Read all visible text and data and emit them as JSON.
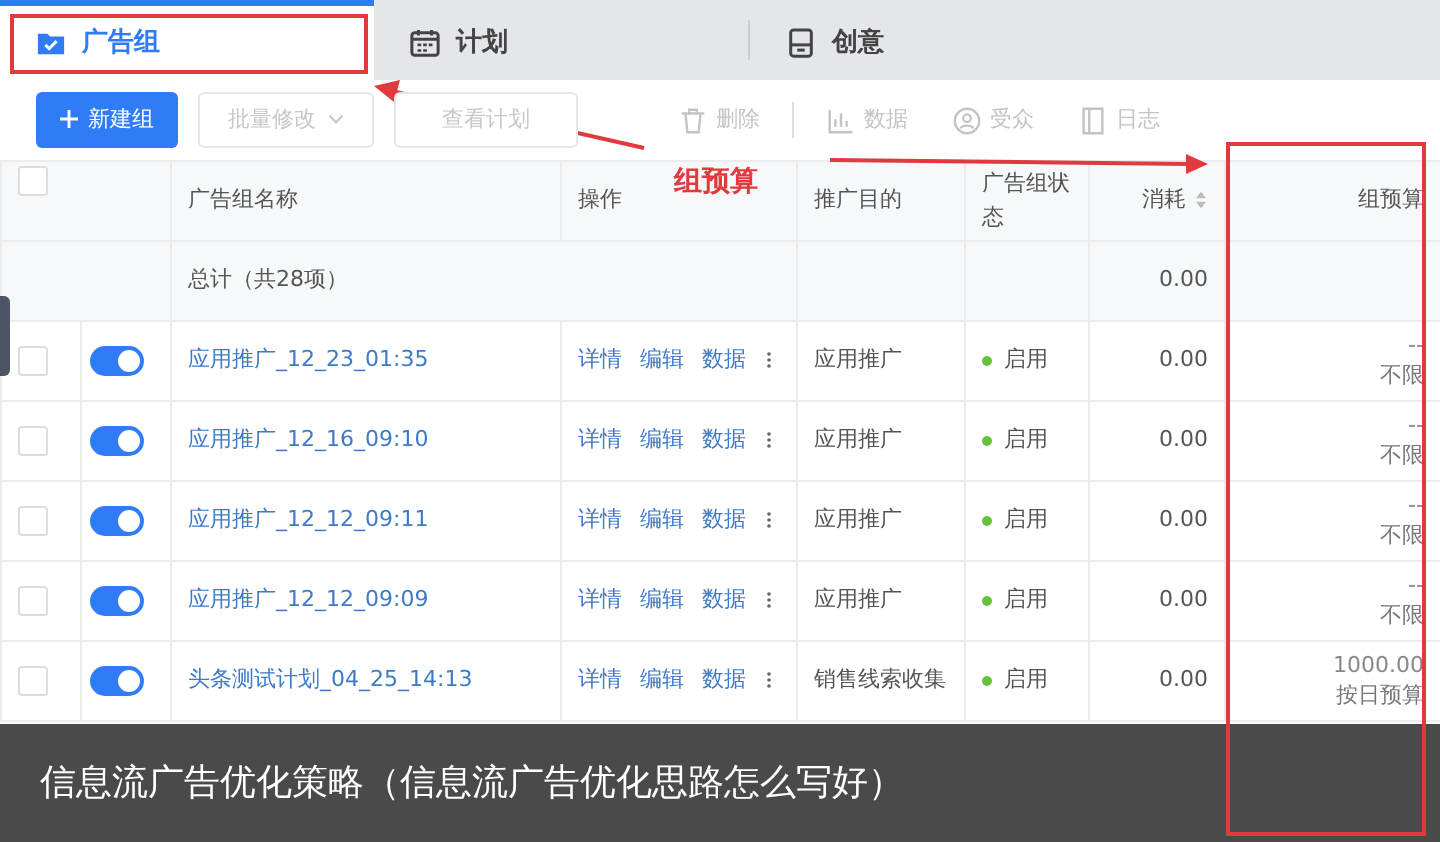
{
  "tabs": [
    {
      "label": "广告组",
      "selected": true
    },
    {
      "label": "计划",
      "selected": false
    },
    {
      "label": "创意",
      "selected": false
    }
  ],
  "toolbar": {
    "primary": "新建组",
    "controls": [
      {
        "label": "批量修改",
        "kind": "dropdown",
        "disabled": true
      },
      {
        "label": "查看计划",
        "kind": "button",
        "disabled": true
      }
    ],
    "actions": [
      {
        "label": "删除",
        "disabled": true
      },
      {
        "label": "数据",
        "disabled": true
      },
      {
        "label": "受众",
        "disabled": true
      },
      {
        "label": "日志",
        "disabled": true
      }
    ]
  },
  "table": {
    "select_all_checked": false,
    "columns": [
      {
        "label": "广告组名称",
        "sortable": false
      },
      {
        "label": "操作",
        "sortable": false
      },
      {
        "label": "推广目的",
        "sortable": false
      },
      {
        "label": "广告组状态",
        "sortable": false
      },
      {
        "label": "消耗",
        "sortable": true
      },
      {
        "label": "组预算",
        "sortable": false
      }
    ],
    "total_row": {
      "label": "总计（共28项）",
      "cost": "0.00"
    },
    "rows": [
      {
        "checked": false,
        "enabled": true,
        "name": "应用推广_12_23_01:35",
        "actions": [
          "详情",
          "编辑",
          "数据"
        ],
        "purpose": "应用推广",
        "status": "启用",
        "status_on": true,
        "cost": "0.00",
        "budget": "--",
        "budget_type": "不限"
      },
      {
        "checked": false,
        "enabled": true,
        "name": "应用推广_12_16_09:10",
        "actions": [
          "详情",
          "编辑",
          "数据"
        ],
        "purpose": "应用推广",
        "status": "启用",
        "status_on": true,
        "cost": "0.00",
        "budget": "--",
        "budget_type": "不限"
      },
      {
        "checked": false,
        "enabled": true,
        "name": "应用推广_12_12_09:11",
        "actions": [
          "详情",
          "编辑",
          "数据"
        ],
        "purpose": "应用推广",
        "status": "启用",
        "status_on": true,
        "cost": "0.00",
        "budget": "--",
        "budget_type": "不限"
      },
      {
        "checked": false,
        "enabled": true,
        "name": "应用推广_12_12_09:09",
        "actions": [
          "详情",
          "编辑",
          "数据"
        ],
        "purpose": "应用推广",
        "status": "启用",
        "status_on": true,
        "cost": "0.00",
        "budget": "--",
        "budget_type": "不限"
      },
      {
        "checked": false,
        "enabled": true,
        "name": "头条测试计划_04_25_14:13",
        "actions": [
          "详情",
          "编辑",
          "数据"
        ],
        "purpose": "销售线索收集",
        "status": "启用",
        "status_on": true,
        "cost": "0.00",
        "budget": "1000.00",
        "budget_type": "按日预算"
      }
    ]
  },
  "annotation": {
    "label": "组预算"
  },
  "caption": "信息流广告优化策略（信息流广告优化思路怎么写好）"
}
